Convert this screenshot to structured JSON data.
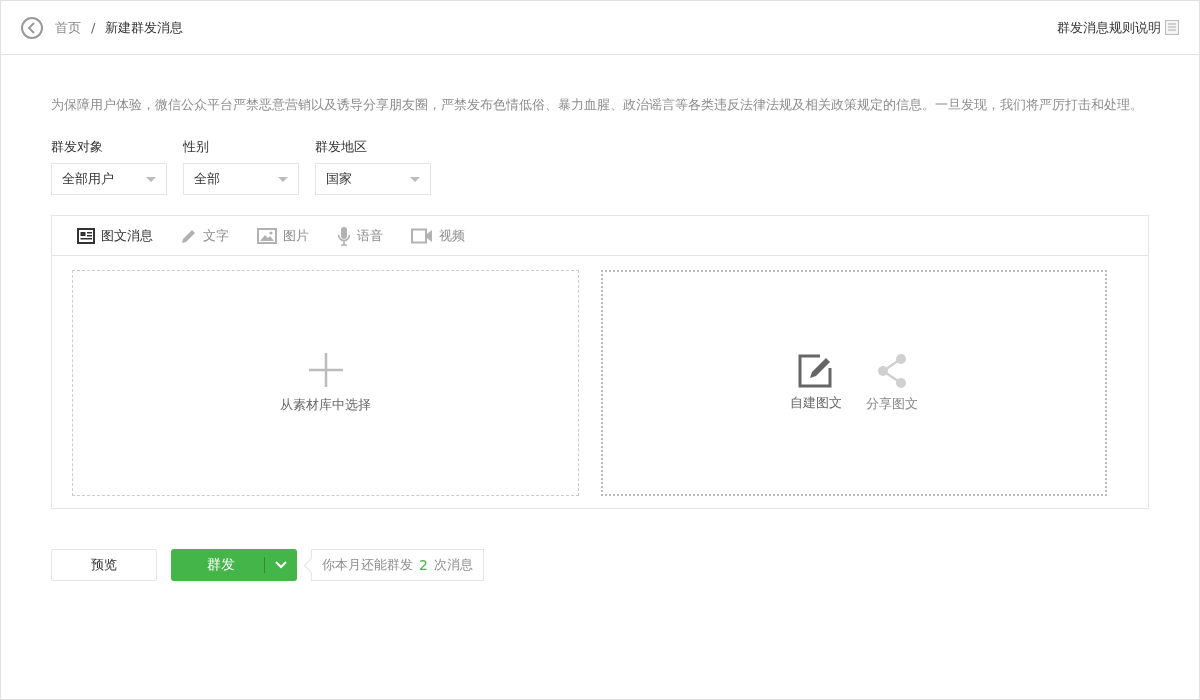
{
  "breadcrumb": {
    "home": "首页",
    "separator": "/",
    "current": "新建群发消息"
  },
  "rules_link": "群发消息规则说明",
  "notice": "为保障用户体验，微信公众平台严禁恶意营销以及诱导分享朋友圈，严禁发布色情低俗、暴力血腥、政治谣言等各类违反法律法规及相关政策规定的信息。一旦发现，我们将严厉打击和处理。",
  "filters": [
    {
      "label": "群发对象",
      "value": "全部用户"
    },
    {
      "label": "性别",
      "value": "全部"
    },
    {
      "label": "群发地区",
      "value": "国家"
    }
  ],
  "tabs": [
    {
      "kind": "news",
      "label": "图文消息",
      "selected": true
    },
    {
      "kind": "text",
      "label": "文字",
      "selected": false
    },
    {
      "kind": "image",
      "label": "图片",
      "selected": false
    },
    {
      "kind": "voice",
      "label": "语音",
      "selected": false
    },
    {
      "kind": "video",
      "label": "视频",
      "selected": false
    }
  ],
  "library_card": {
    "label": "从素材库中选择"
  },
  "create_options": [
    {
      "kind": "create",
      "label": "自建图文",
      "disabled": false
    },
    {
      "kind": "share",
      "label": "分享图文",
      "disabled": true
    }
  ],
  "buttons": {
    "preview": "预览",
    "send": "群发"
  },
  "quota": {
    "prefix": "你本月还能群发",
    "count": "2",
    "suffix": "次消息"
  }
}
